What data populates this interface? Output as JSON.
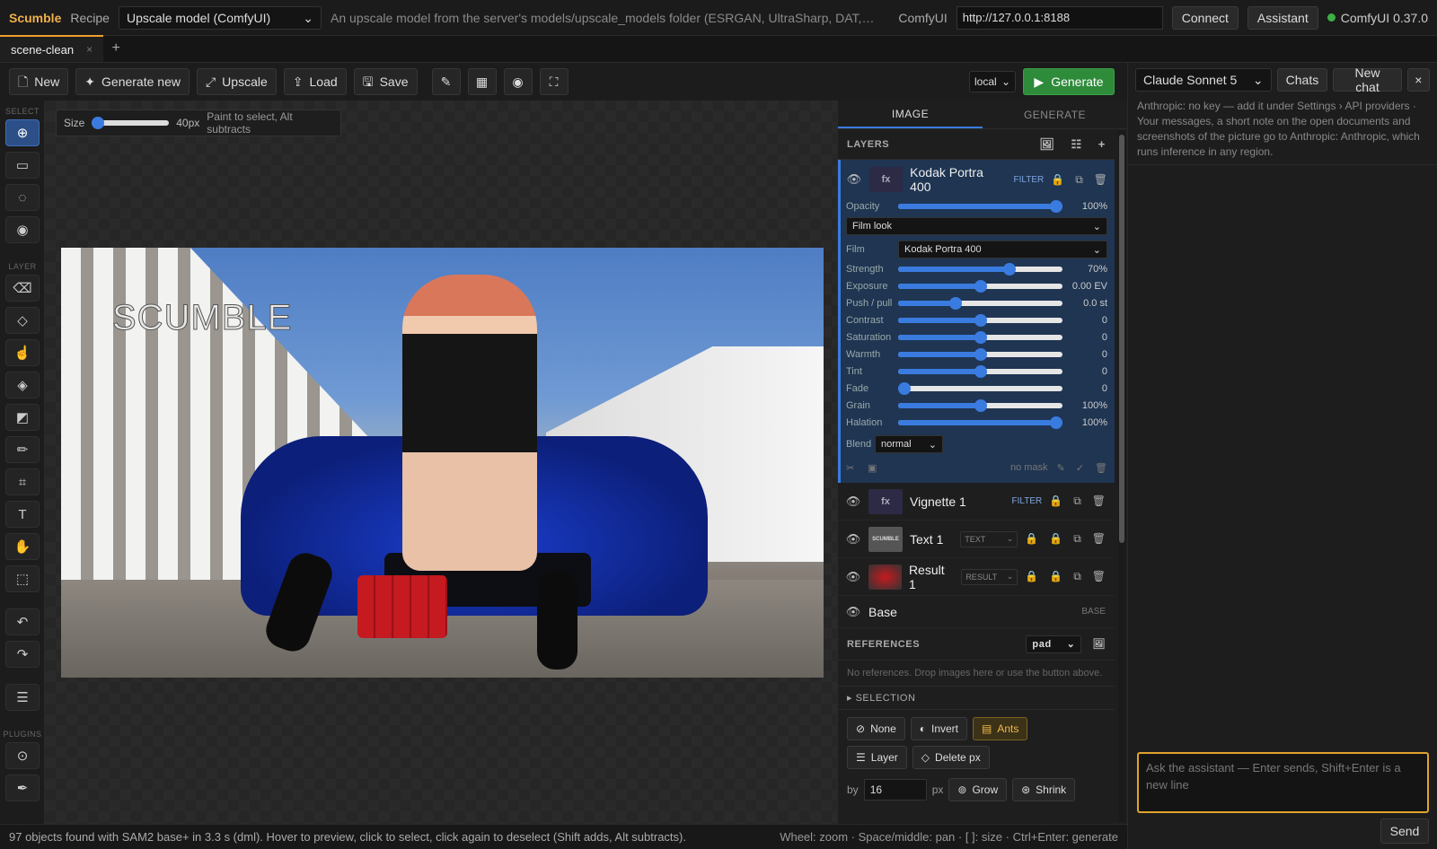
{
  "topbar": {
    "brand": "Scumble",
    "recipe_label": "Recipe",
    "recipe_value": "Upscale model (ComfyUI)",
    "recipe_desc": "An upscale model from the server's models/upscale_models folder (ESRGAN, UltraSharp, DAT, ...), picked ...",
    "comfy_label": "ComfyUI",
    "url": "http://127.0.0.1:8188",
    "connect": "Connect",
    "assistant": "Assistant",
    "status": "ComfyUI 0.37.0",
    "status_color": "#3cb043"
  },
  "tabs": {
    "doc": "scene-clean",
    "close": "×",
    "add": "+"
  },
  "toolbar": {
    "new": "New",
    "generate_new": "Generate new",
    "upscale": "Upscale",
    "load": "Load",
    "save": "Save",
    "local": "local",
    "generate": "Generate",
    "generate_color": "#2e8b3a"
  },
  "lefttools": {
    "select": "SELECT",
    "layer": "LAYER",
    "plugins": "PLUGINS"
  },
  "brush": {
    "size_label": "Size",
    "size_value": "40px",
    "hint": "Paint to select, Alt subtracts"
  },
  "photo": {
    "overlay_text": "SCUMBLE"
  },
  "panel": {
    "tab_image": "IMAGE",
    "tab_generate": "GENERATE",
    "layers_title": "LAYERS",
    "active_layer": {
      "name": "Kodak Portra 400",
      "thumb": "fx",
      "tag": "FILTER",
      "opacity_label": "Opacity",
      "opacity_value": "100%",
      "opacity_level": 1.0,
      "look": "Film look",
      "film_label": "Film",
      "film_value": "Kodak Portra 400",
      "params": [
        {
          "label": "Strength",
          "value": "70%",
          "level": 0.68
        },
        {
          "label": "Exposure",
          "value": "0.00 EV",
          "level": 0.5
        },
        {
          "label": "Push / pull",
          "value": "0.0 st",
          "level": 0.35
        },
        {
          "label": "Contrast",
          "value": "0",
          "level": 0.5
        },
        {
          "label": "Saturation",
          "value": "0",
          "level": 0.5
        },
        {
          "label": "Warmth",
          "value": "0",
          "level": 0.5
        },
        {
          "label": "Tint",
          "value": "0",
          "level": 0.5
        },
        {
          "label": "Fade",
          "value": "0",
          "level": 0.04
        },
        {
          "label": "Grain",
          "value": "100%",
          "level": 0.5
        },
        {
          "label": "Halation",
          "value": "100%",
          "level": 0.96
        }
      ],
      "blend_label": "Blend",
      "blend_value": "normal",
      "mask": "no mask"
    },
    "layers": [
      {
        "name": "Vignette 1",
        "thumb": "fx",
        "tag": "FILTER"
      },
      {
        "name": "Text 1",
        "thumb": "SCUMBLE",
        "type": "TEXT"
      },
      {
        "name": "Result 1",
        "thumb": "",
        "type": "RESULT"
      }
    ],
    "base": {
      "name": "Base",
      "tag": "BASE"
    },
    "references_title": "REFERENCES",
    "references_mode": "pad",
    "references_empty": "No references. Drop images here or use the button above.",
    "selection_title": "SELECTION",
    "sel_none": "None",
    "sel_invert": "Invert",
    "sel_ants": "Ants",
    "sel_layer": "Layer",
    "sel_delete": "Delete px",
    "by_label": "by",
    "by_value": "16",
    "px_label": "px",
    "grow": "Grow",
    "shrink": "Shrink"
  },
  "chat": {
    "model": "Claude Sonnet 5",
    "chats": "Chats",
    "new_chat": "New chat",
    "close": "×",
    "note": "Anthropic: no key — add it under Settings › API providers · Your messages, a short note on the open documents and screenshots of the picture go to Anthropic: Anthropic, which runs inference in any region.",
    "placeholder": "Ask the assistant — Enter sends, Shift+Enter is a new line",
    "send": "Send",
    "accent": "#e0a32c"
  },
  "statusbar": {
    "left": "97 objects found with SAM2 base+ in 3.3 s (dml). Hover to preview, click to select, click again to deselect (Shift adds, Alt subtracts).",
    "right": "Wheel: zoom · Space/middle: pan · [ ]: size · Ctrl+Enter: generate"
  }
}
